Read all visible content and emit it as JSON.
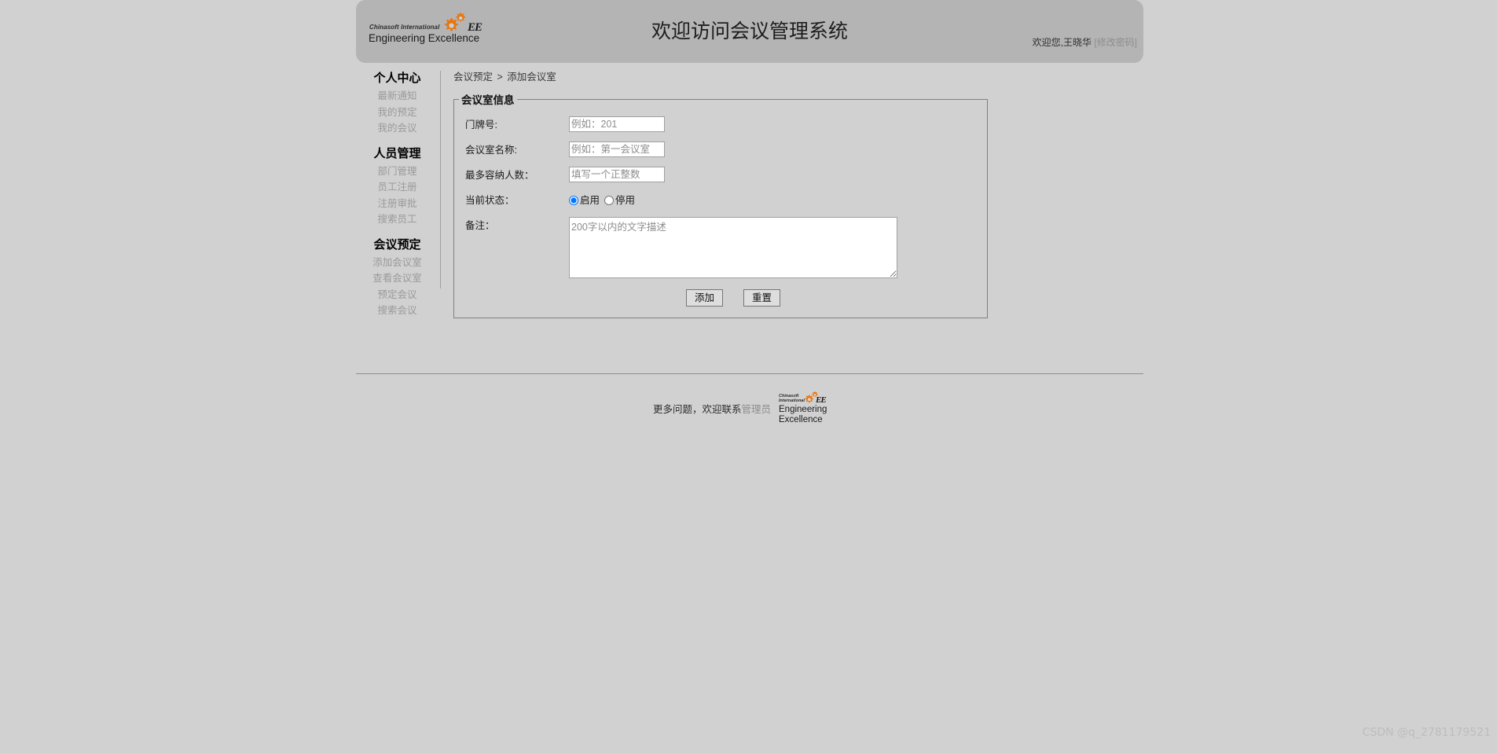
{
  "header": {
    "title": "欢迎访问会议管理系统",
    "welcome_prefix": "欢迎您,",
    "user_name": "王晓华",
    "change_password_label": "[修改密码]",
    "logo": {
      "line1": "Chinasoft International",
      "line2": "Engineering Excellence",
      "mark": "EE",
      "gear_color": "#e8760f"
    },
    "bg_color": "#b4b4b4"
  },
  "sidebar": {
    "groups": [
      {
        "title": "个人中心",
        "items": [
          {
            "label": "最新通知"
          },
          {
            "label": "我的预定"
          },
          {
            "label": "我的会议"
          }
        ]
      },
      {
        "title": "人员管理",
        "items": [
          {
            "label": "部门管理"
          },
          {
            "label": "员工注册"
          },
          {
            "label": "注册审批"
          },
          {
            "label": "搜索员工"
          }
        ]
      },
      {
        "title": "会议预定",
        "items": [
          {
            "label": "添加会议室"
          },
          {
            "label": "查看会议室"
          },
          {
            "label": "预定会议"
          },
          {
            "label": "搜索会议"
          }
        ]
      }
    ]
  },
  "breadcrumb": {
    "parent": "会议预定",
    "separator": ">",
    "current": "添加会议室"
  },
  "form": {
    "legend": "会议室信息",
    "fields": {
      "room_number": {
        "label": "门牌号:",
        "placeholder": "例如：201",
        "value": ""
      },
      "room_name": {
        "label": "会议室名称:",
        "placeholder": "例如：第一会议室",
        "value": ""
      },
      "capacity": {
        "label": "最多容纳人数：",
        "placeholder": "填写一个正整数",
        "value": ""
      },
      "status": {
        "label": "当前状态：",
        "options": [
          {
            "label": "启用",
            "selected": true
          },
          {
            "label": "停用",
            "selected": false
          }
        ]
      },
      "remark": {
        "label": "备注：",
        "placeholder": "200字以内的文字描述",
        "value": ""
      }
    },
    "submit_label": "添加",
    "reset_label": "重置"
  },
  "footer": {
    "text_prefix": "更多问题，欢迎联系",
    "admin_label": "管理员",
    "logo": {
      "line1a": "Chinasoft",
      "line1b": "International",
      "line2a": "Engineering",
      "line2b": "Excellence",
      "mark": "EE"
    }
  },
  "watermark": "CSDN @q_2781179521"
}
